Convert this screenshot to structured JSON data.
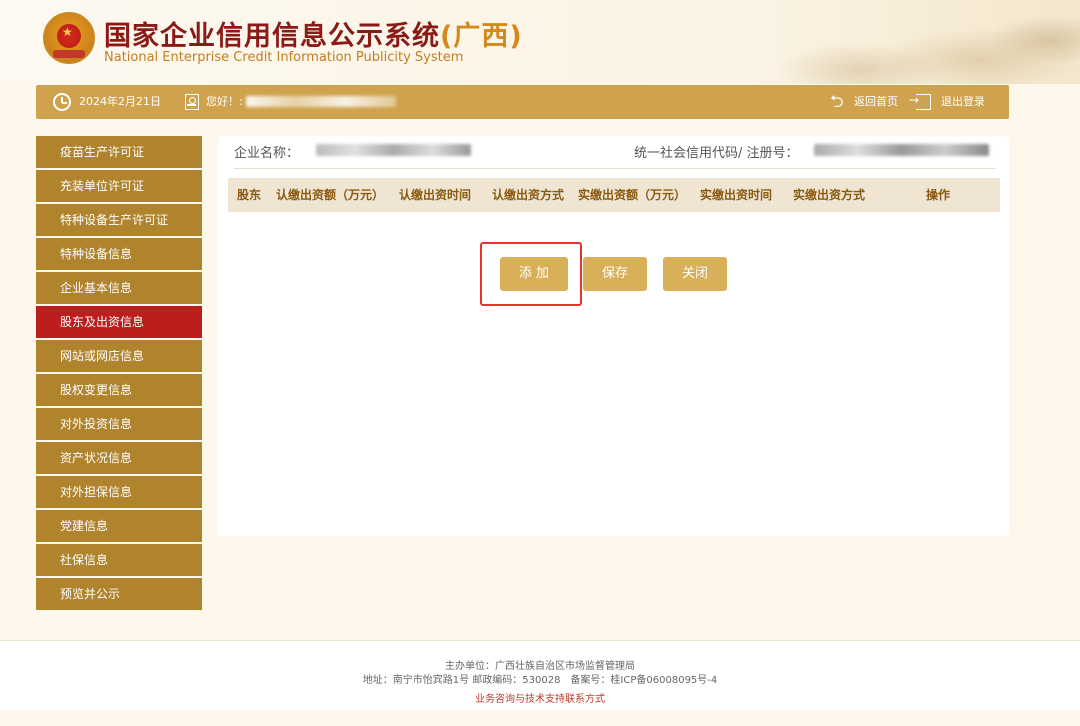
{
  "header": {
    "title_cn": "国家企业信用信息公示系统",
    "title_region": "(广西)",
    "title_en": "National Enterprise Credit Information Publicity System"
  },
  "topbar": {
    "date": "2024年2月21日",
    "greeting": "您好！:",
    "back_home": "返回首页",
    "logout": "退出登录"
  },
  "sidebar": {
    "items": [
      {
        "label": "疫苗生产许可证"
      },
      {
        "label": "充装单位许可证"
      },
      {
        "label": "特种设备生产许可证"
      },
      {
        "label": "特种设备信息"
      },
      {
        "label": "企业基本信息"
      },
      {
        "label": "股东及出资信息",
        "active": true
      },
      {
        "label": "网站或网店信息"
      },
      {
        "label": "股权变更信息"
      },
      {
        "label": "对外投资信息"
      },
      {
        "label": "资产状况信息"
      },
      {
        "label": "对外担保信息"
      },
      {
        "label": "党建信息"
      },
      {
        "label": "社保信息"
      },
      {
        "label": "预览并公示"
      }
    ]
  },
  "main": {
    "company_label": "企业名称：",
    "code_label": "统一社会信用代码/ 注册号：",
    "table_headers": [
      "股东",
      "认缴出资额（万元）",
      "认缴出资时间",
      "认缴出资方式",
      "实缴出资额（万元）",
      "实缴出资时间",
      "实缴出资方式",
      "操作"
    ],
    "buttons": {
      "add": "添 加",
      "save": "保存",
      "close": "关闭"
    }
  },
  "footer": {
    "sponsor": "主办单位：广西壮族自治区市场监督管理局",
    "address": "地址：南宁市怡宾路1号 邮政编码：530028　备案号：桂ICP备06008095号-4",
    "contact_link": "业务咨询与技术支持联系方式"
  },
  "colors": {
    "brand_gold": "#cfa34d",
    "sidebar_bg": "#b0832d",
    "sidebar_active": "#bc1e1e",
    "title_red": "#8b1a16",
    "button_gold": "#d9b05a",
    "highlight_red": "#e8322c"
  }
}
